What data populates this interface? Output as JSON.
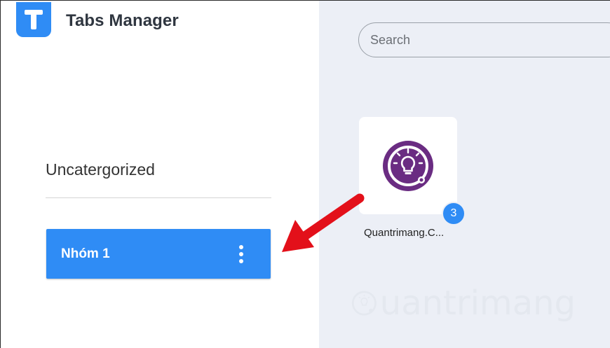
{
  "app": {
    "title": "Tabs Manager",
    "logo_letter": "T"
  },
  "sidebar": {
    "category_title": "Uncatergorized",
    "groups": [
      {
        "label": "Nhóm 1"
      }
    ]
  },
  "main": {
    "search": {
      "placeholder": "Search",
      "value": ""
    },
    "tabs": [
      {
        "caption": "Quantrimang.C...",
        "count": "3",
        "icon": "lightbulb-icon"
      }
    ]
  },
  "watermark": {
    "text": "uantrimang"
  },
  "colors": {
    "accent": "#2f8cf5",
    "main_background": "#eceff6",
    "site_icon": "#6a2c82",
    "annotation_arrow": "#e3101a"
  }
}
